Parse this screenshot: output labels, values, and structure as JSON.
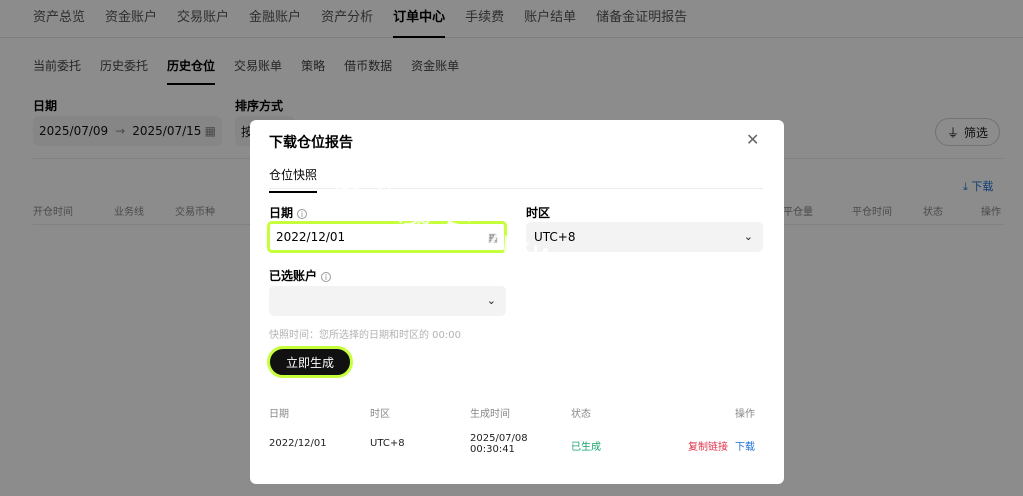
{
  "top_nav": {
    "items": [
      "资产总览",
      "资金账户",
      "交易账户",
      "金融账户",
      "资产分析",
      "订单中心",
      "手续费",
      "账户结单",
      "储备金证明报告"
    ],
    "active": "订单中心"
  },
  "sub_nav": {
    "items": [
      "当前委托",
      "历史委托",
      "历史仓位",
      "交易账单",
      "策略",
      "借币数据",
      "资金账单"
    ],
    "active": "历史仓位"
  },
  "filters": {
    "date_label": "日期",
    "date_start": "2025/07/09",
    "date_end": "2025/07/15",
    "sort_label": "排序方式",
    "sort_value": "按",
    "filter_button": "筛选"
  },
  "download_link": "下载",
  "table_headers": [
    "开仓时间",
    "业务线",
    "交易币种",
    "已平仓量",
    "平仓时间",
    "状态",
    "操作"
  ],
  "modal": {
    "title": "下载仓位报告",
    "tab": "仓位快照",
    "date_label": "日期",
    "date_value": "2022/12/01",
    "timezone_label": "时区",
    "timezone_value": "UTC+8",
    "account_label": "已选账户",
    "account_value": "",
    "hint": "快照时间：您所选择的日期和时区的 00:00",
    "generate_button": "立即生成",
    "table_headers": [
      "日期",
      "时区",
      "生成时间",
      "状态",
      "操作"
    ],
    "rows": [
      {
        "date": "2022/12/01",
        "timezone": "UTC+8",
        "generated_date": "2025/07/08",
        "generated_time": "00:30:41",
        "status": "已生成",
        "copy_link": "复制链接",
        "download": "下载"
      }
    ]
  },
  "watermark": "量化魔方www.115KU.com",
  "colors": {
    "accent_highlight": "#c6ff3b",
    "status_green": "#1aa36b",
    "link_red": "#e0334a",
    "link_blue": "#1a6fd6"
  }
}
